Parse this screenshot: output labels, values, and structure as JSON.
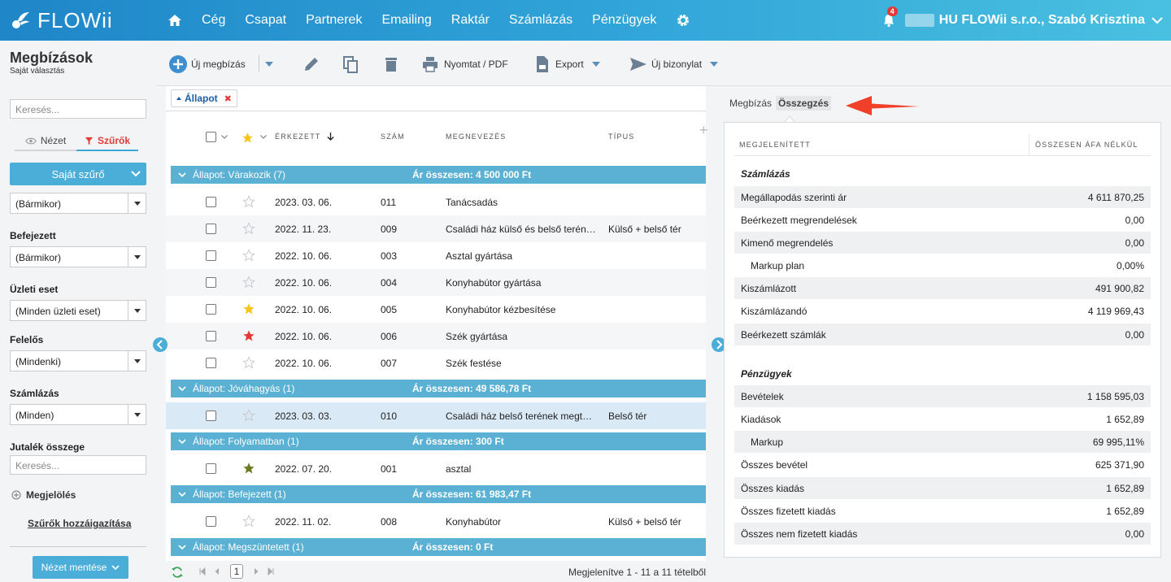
{
  "app": {
    "logo_text": "FLOWii"
  },
  "nav": {
    "items": [
      "Cég",
      "Csapat",
      "Partnerek",
      "Emailing",
      "Raktár",
      "Számlázás",
      "Pénzügyek"
    ],
    "notification_count": "4",
    "account": "HU FLOWii s.r.o., Szabó Krisztina"
  },
  "page": {
    "title": "Megbízások",
    "subtitle": "Saját választás"
  },
  "sidebar": {
    "search_placeholder": "Keresés...",
    "view_tab": "Nézet",
    "filter_tab": "Szűrők",
    "own_filter": "Saját szűrő",
    "first_select": "(Bármikor)",
    "filters": [
      {
        "label": "Befejezett",
        "value": "(Bármikor)"
      },
      {
        "label": "Üzleti eset",
        "value": "(Minden üzleti eset)"
      },
      {
        "label": "Felelős",
        "value": "(Mindenki)"
      },
      {
        "label": "Számlázás",
        "value": "(Minden)"
      }
    ],
    "commission_label": "Jutalék összege",
    "commission_placeholder": "Keresés...",
    "marking": "Megjelölés",
    "assign_filters": "Szűrők hozzáigazítása",
    "save_view": "Nézet mentése"
  },
  "toolbar": {
    "new_order": "Új megbízás",
    "print": "Nyomtat / PDF",
    "export": "Export",
    "new_doc": "Új bizonylat"
  },
  "list": {
    "filter_chip": "Állapot",
    "columns": {
      "received": "ÉRKEZETT",
      "number": "SZÁM",
      "name": "MEGNEVEZÉS",
      "type": "TÍPUS"
    },
    "groups": [
      {
        "label": "Állapot: Várakozik (7)",
        "total": "Ár összesen: 4 500 000 Ft",
        "rows": [
          {
            "date": "2023. 03. 06.",
            "num": "011",
            "name": "Tanácsadás",
            "type": "",
            "star": "none"
          },
          {
            "date": "2022. 11. 23.",
            "num": "009",
            "name": "Családi ház külső és belső terének megtervezése",
            "type": "Külső + belső tér",
            "star": "none"
          },
          {
            "date": "2022. 10. 06.",
            "num": "003",
            "name": "Asztal gyártása",
            "type": "",
            "star": "none"
          },
          {
            "date": "2022. 10. 06.",
            "num": "004",
            "name": "Konyhabútor gyártása",
            "type": "",
            "star": "none"
          },
          {
            "date": "2022. 10. 06.",
            "num": "005",
            "name": "Konyhabútor kézbesítése",
            "type": "",
            "star": "#f5c518"
          },
          {
            "date": "2022. 10. 06.",
            "num": "006",
            "name": "Szék gyártása",
            "type": "",
            "star": "#e53935"
          },
          {
            "date": "2022. 10. 06.",
            "num": "007",
            "name": "Szék festése",
            "type": "",
            "star": "none"
          }
        ]
      },
      {
        "label": "Állapot: Jóváhagyás (1)",
        "total": "Ár összesen: 49 586,78 Ft",
        "rows": [
          {
            "date": "2023. 03. 03.",
            "num": "010",
            "name": "Családi ház belső terének megtervezése",
            "type": "Belső tér",
            "star": "none",
            "selected": true
          }
        ]
      },
      {
        "label": "Állapot: Folyamatban (1)",
        "total": "Ár összesen: 300 Ft",
        "rows": [
          {
            "date": "2022. 07. 20.",
            "num": "001",
            "name": "asztal",
            "type": "",
            "star": "#6b7a1e"
          }
        ]
      },
      {
        "label": "Állapot: Befejezett (1)",
        "total": "Ár összesen: 61 983,47 Ft",
        "rows": [
          {
            "date": "2022. 11. 02.",
            "num": "008",
            "name": "Konyhabútor",
            "type": "Külső + belső tér",
            "star": "none"
          }
        ]
      },
      {
        "label": "Állapot: Megszüntetett (1)",
        "total": "Ár összesen: 0 Ft",
        "rows": []
      }
    ],
    "pager": {
      "page": "1",
      "info": "Megjelenítve 1 - 11 a 11 tételből"
    }
  },
  "summary": {
    "tab_orders": "Megbízás",
    "tab_summary": "Összegzés",
    "head_left": "MEGJELENÍTETT",
    "head_right": "ÖSSZESEN ÁFA NÉLKÜL",
    "sections": [
      {
        "title": "Számlázás",
        "rows": [
          {
            "label": "Megállapodás szerinti ár",
            "value": "4 611 870,25"
          },
          {
            "label": "Beérkezett megrendelések",
            "value": "0,00"
          },
          {
            "label": "Kimenő megrendelés",
            "value": "0,00"
          },
          {
            "label": "Markup plan",
            "value": "0,00%",
            "indent": true
          },
          {
            "label": "Kiszámlázott",
            "value": "491 900,82"
          },
          {
            "label": "Kiszámlázandó",
            "value": "4 119 969,43"
          },
          {
            "label": "Beérkezett számlák",
            "value": "0,00"
          }
        ]
      },
      {
        "title": "Pénzügyek",
        "rows": [
          {
            "label": "Bevételek",
            "value": "1 158 595,03"
          },
          {
            "label": "Kiadások",
            "value": "1 652,89"
          },
          {
            "label": "Markup",
            "value": "69 995,11%",
            "indent": true
          },
          {
            "label": "Összes bevétel",
            "value": "625 371,90"
          },
          {
            "label": "Összes kiadás",
            "value": "1 652,89"
          },
          {
            "label": "Összes fizetett kiadás",
            "value": "1 652,89"
          },
          {
            "label": "Összes nem fizetett kiadás",
            "value": "0,00"
          }
        ]
      }
    ]
  },
  "colors": {
    "nav_start": "#1f86c8",
    "nav_end": "#49c0e0",
    "accent": "#4baed8",
    "group_row": "#5bb1d3",
    "danger": "#e53935"
  },
  "icons": [
    "logo-icon",
    "home-icon",
    "gear-icon",
    "bell-icon",
    "eye-icon",
    "filter-icon",
    "plus-circle-icon",
    "pencil-icon",
    "copy-icon",
    "trash-icon",
    "printer-icon",
    "export-file-icon",
    "send-icon",
    "star-icon",
    "refresh-icon",
    "red-arrow-icon"
  ]
}
